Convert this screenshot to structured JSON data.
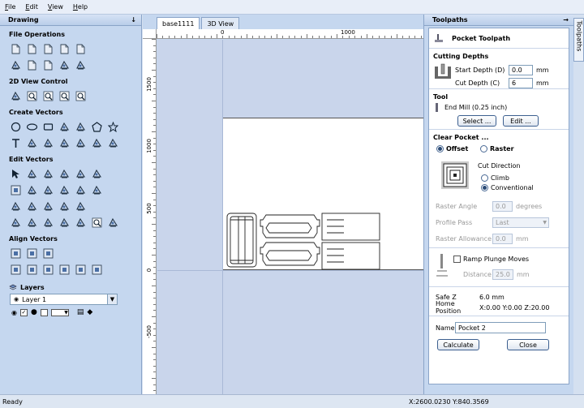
{
  "menu": [
    "File",
    "Edit",
    "View",
    "Help"
  ],
  "drawing": {
    "title": "Drawing",
    "sections": [
      {
        "title": "File Operations",
        "rows": [
          [
            "new-file-icon",
            "open-file-icon",
            "save-icon",
            "import-icon",
            "export-icon"
          ],
          [
            "cut-icon",
            "copy-icon",
            "paste-icon",
            "undo-icon",
            "redo-icon"
          ]
        ]
      },
      {
        "title": "2D View Control",
        "rows": [
          [
            "pan-icon",
            "zoom-box-icon",
            "zoom-all-icon",
            "zoom-extents-icon",
            "fit-view-icon"
          ]
        ]
      },
      {
        "title": "Create Vectors",
        "rows": [
          [
            "circle-icon",
            "ellipse-icon",
            "rectangle-icon",
            "polyline-icon",
            "spiral-icon",
            "polygon-icon",
            "star-icon"
          ],
          [
            "text-icon",
            "text-on-curve-icon",
            "dimension-icon",
            "arc-text-icon",
            "gear-shape-icon",
            "dog-bone-icon",
            "select-draw-icon"
          ]
        ]
      },
      {
        "title": "Edit Vectors",
        "rows": [
          [
            "select-icon",
            "node-edit-icon",
            "transform-icon",
            "move-icon",
            "scale-icon",
            "rotate-icon"
          ],
          [
            "align-icon",
            "mirror-icon",
            "array-icon",
            "group-icon",
            "ungroup-icon",
            "join-icon"
          ],
          [
            "weld-icon",
            "subtract-icon",
            "intersect-icon",
            "offset-icon",
            "trim-icon"
          ],
          [
            "smooth-icon",
            "fillet-icon",
            "chamfer-icon",
            "extend-icon",
            "close-vector-icon",
            "fit-curve-icon",
            "nest-icon"
          ]
        ]
      },
      {
        "title": "Align Vectors",
        "rows": [
          [
            "align-center-icon",
            "align-horizontal-icon",
            "align-vertical-icon"
          ],
          [
            "align-left-icon",
            "align-right-icon",
            "align-top-icon",
            "align-bottom-icon",
            "align-middle-icon",
            "align-page-icon"
          ]
        ]
      }
    ],
    "layers": {
      "title": "Layers",
      "current": "Layer 1"
    }
  },
  "tabs": [
    "base1111",
    "3D View"
  ],
  "rulers": {
    "h": [
      "0",
      "1000"
    ],
    "v": [
      "1500",
      "1000",
      "500",
      "0",
      "-500"
    ]
  },
  "toolpaths": {
    "panel_title": "Toolpaths",
    "side_tab": "Toolpaths",
    "form_title": "Pocket Toolpath",
    "cutting_depths": {
      "title": "Cutting Depths",
      "start_label": "Start Depth (D)",
      "start_value": "0.0",
      "start_unit": "mm",
      "cut_label": "Cut Depth (C)",
      "cut_value": "6",
      "cut_unit": "mm"
    },
    "tool": {
      "title": "Tool",
      "name": "End Mill (0.25 inch)",
      "select_label": "Select ...",
      "edit_label": "Edit ..."
    },
    "clear_pocket": {
      "title": "Clear Pocket ...",
      "offset_label": "Offset",
      "raster_label": "Raster",
      "cut_direction_label": "Cut Direction",
      "climb_label": "Climb",
      "conventional_label": "Conventional",
      "raster_angle_label": "Raster Angle",
      "raster_angle_value": "0.0",
      "raster_angle_unit": "degrees",
      "profile_pass_label": "Profile Pass",
      "profile_pass_value": "Last",
      "raster_allowance_label": "Raster Allowance",
      "raster_allowance_value": "0.0",
      "raster_allowance_unit": "mm"
    },
    "ramp": {
      "label": "Ramp Plunge Moves",
      "distance_label": "Distance",
      "distance_value": "25.0",
      "distance_unit": "mm"
    },
    "safe_z_label": "Safe Z",
    "safe_z_value": "6.0 mm",
    "home_label": "Home Position",
    "home_value": "X:0.00 Y:0.00 Z:20.00",
    "name_label": "Name:",
    "name_value": "Pocket 2",
    "calculate_label": "Calculate",
    "close_label": "Close"
  },
  "status": {
    "left": "Ready",
    "right": "X:2600.0230 Y:840.3569"
  }
}
